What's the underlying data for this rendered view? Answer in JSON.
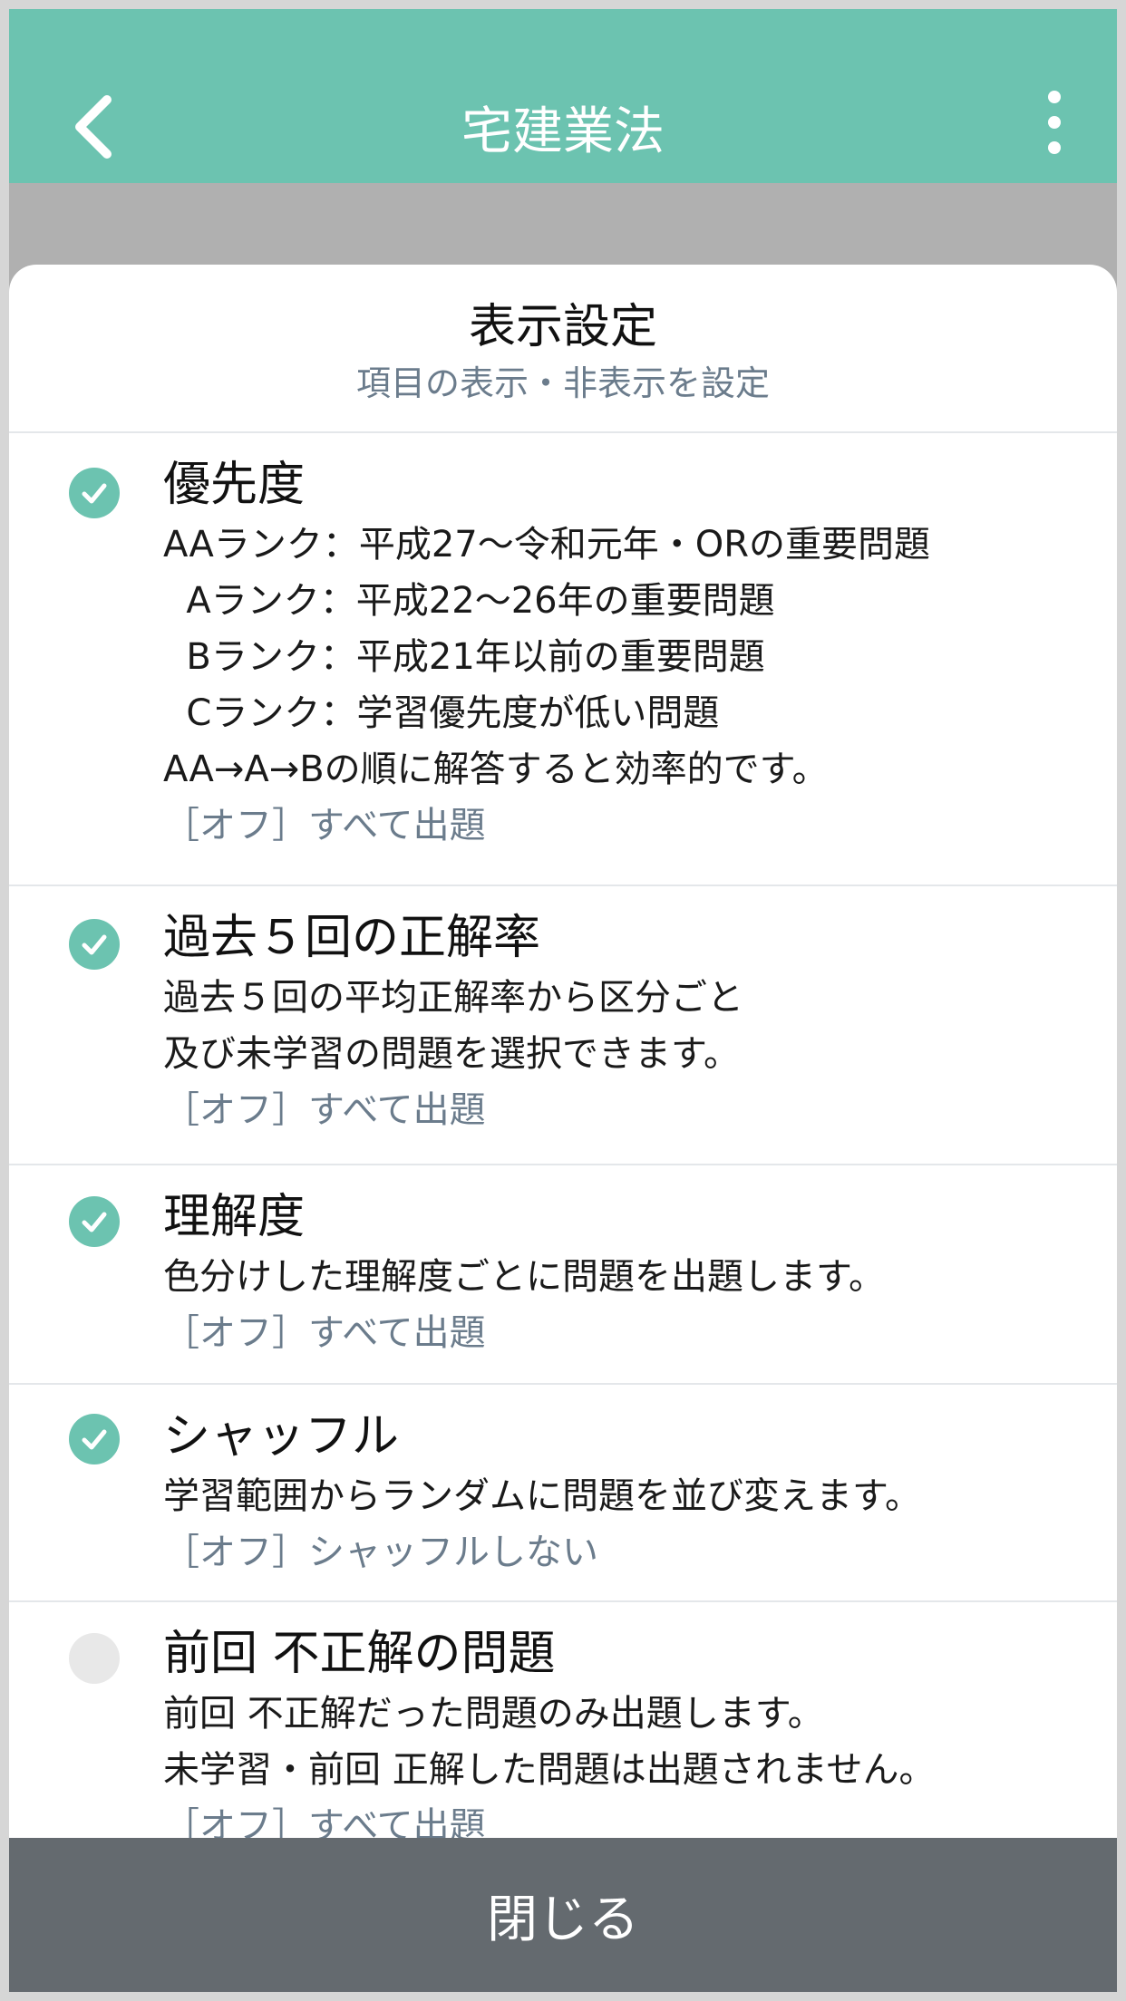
{
  "colors": {
    "accent": "#6cc3b0",
    "close_bar": "#646a6f",
    "muted_text": "#6b7c8c"
  },
  "appbar": {
    "title": "宅建業法",
    "back_icon": "chevron-left-icon",
    "menu_icon": "more-vertical-icon"
  },
  "sheet": {
    "title": "表示設定",
    "subtitle": "項目の表示・非表示を設定"
  },
  "items": [
    {
      "title": "優先度",
      "checked": true,
      "desc": [
        "AAランク：平成27〜令和元年・ORの重要問題",
        "  Aランク：平成22〜26年の重要問題",
        "  Bランク：平成21年以前の重要問題",
        "  Cランク：学習優先度が低い問題",
        "AA→A→Bの順に解答すると効率的です。"
      ],
      "off": "［オフ］すべて出題"
    },
    {
      "title": "過去５回の正解率",
      "checked": true,
      "desc": [
        "過去５回の平均正解率から区分ごと",
        "及び未学習の問題を選択できます。"
      ],
      "off": "［オフ］すべて出題"
    },
    {
      "title": "理解度",
      "checked": true,
      "desc": [
        "色分けした理解度ごとに問題を出題します。"
      ],
      "off": "［オフ］すべて出題"
    },
    {
      "title": "シャッフル",
      "checked": true,
      "desc": [
        "学習範囲からランダムに問題を並び変えます。"
      ],
      "off": "［オフ］シャッフルしない"
    },
    {
      "title": "前回 不正解の問題",
      "checked": false,
      "desc": [
        "前回 不正解だった問題のみ出題します。",
        "未学習・前回 正解した問題は出題されません。"
      ],
      "off": "［オフ］すべて出題"
    }
  ],
  "footer": {
    "close_label": "閉じる"
  }
}
